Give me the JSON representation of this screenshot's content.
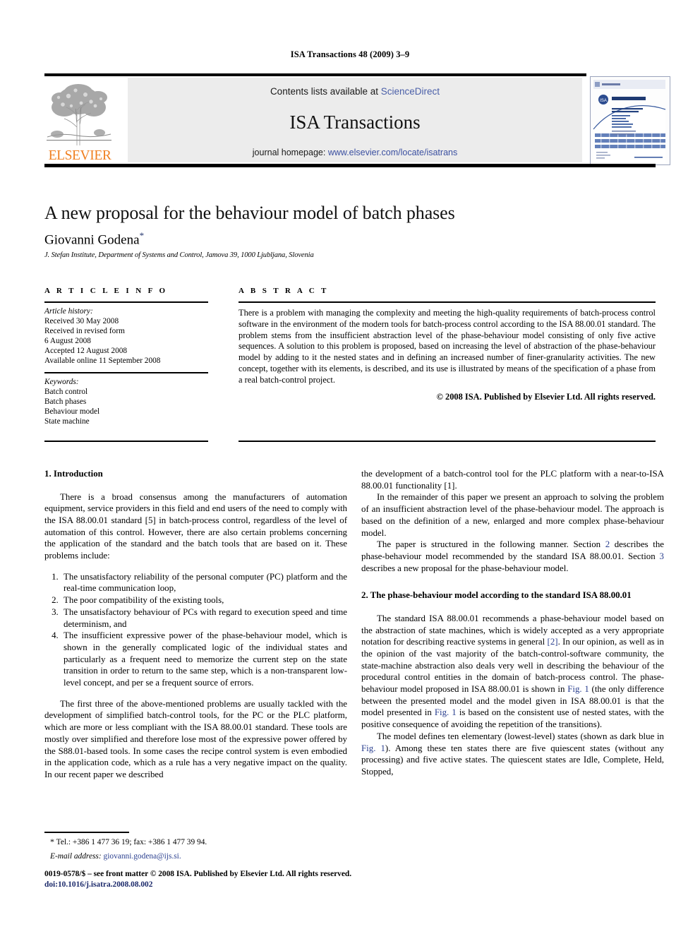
{
  "running_head": "ISA Transactions 48 (2009) 3–9",
  "masthead": {
    "publisher_name": "ELSEVIER",
    "contents_prefix": "Contents lists available at ",
    "contents_link": "ScienceDirect",
    "journal_name": "ISA Transactions",
    "homepage_prefix": "journal homepage: ",
    "homepage_url": "www.elsevier.com/locate/isatrans",
    "cover_header": "Transactions",
    "cover_logo_text": "ISA",
    "cover_title": "Transactions",
    "cover_subtitle": "The Science and Engineering of Measurement and Automation",
    "cover_footer": "Instrumentation, Systems, and Automation Society"
  },
  "title": "A new proposal for the behaviour model of batch phases",
  "author": "Giovanni Godena",
  "author_marker": "*",
  "affiliation": "J. Stefan Institute, Department of Systems and Control, Jamova 39, 1000 Ljubljana, Slovenia",
  "article_info": {
    "heading": "A R T I C L E   I N F O",
    "history_label": "Article history:",
    "history": [
      "Received 30 May 2008",
      "Received in revised form",
      "6 August 2008",
      "Accepted 12 August 2008",
      "Available online 11 September 2008"
    ],
    "keywords_label": "Keywords:",
    "keywords": [
      "Batch control",
      "Batch phases",
      "Behaviour model",
      "State machine"
    ]
  },
  "abstract": {
    "heading": "A B S T R A C T",
    "text": "There is a problem with managing the complexity and meeting the high-quality requirements of batch-process control software in the environment of the modern tools for batch-process control according to the ISA 88.00.01 standard. The problem stems from the insufficient abstraction level of the phase-behaviour model consisting of only five active sequences. A solution to this problem is proposed, based on increasing the level of abstraction of the phase-behaviour model by adding to it the nested states and in defining an increased number of finer-granularity activities. The new concept, together with its elements, is described, and its use is illustrated by means of the specification of a phase from a real batch-control project.",
    "copyright": "© 2008 ISA. Published by Elsevier Ltd. All rights reserved."
  },
  "sections": {
    "intro": {
      "heading": "1.  Introduction",
      "p1": "There is a broad consensus among the manufacturers of automation equipment, service providers in this field and end users of the need to comply with the ISA 88.00.01 standard [5] in batch-process control, regardless of the level of automation of this control. However, there are also certain problems concerning the application of the standard and the batch tools that are based on it. These problems include:",
      "p1_ref": "[5]",
      "problems": [
        "The unsatisfactory reliability of the personal computer (PC) platform and the real-time communication loop,",
        "The poor compatibility of the existing tools,",
        "The unsatisfactory behaviour of PCs with regard to execution speed and time determinism, and",
        "The insufficient expressive power of the phase-behaviour model, which is shown in the generally complicated logic of the individual states and particularly as a frequent need to memorize the current step on the state transition in order to return to the same step, which is a non-transparent low-level concept, and per se a frequent source of errors."
      ],
      "p2": "The first three of the above-mentioned problems are usually tackled with the development of simplified batch-control tools, for the PC or the PLC platform, which are more or less compliant with the ISA 88.00.01 standard. These tools are mostly over simplified and therefore lose most of the expressive power offered by the S88.01-based tools. In some cases the recipe control system is even embodied in the application code, which as a rule has a very negative impact on the quality. In our recent paper we described",
      "p2_cont": "the development of a batch-control tool for the PLC platform with a near-to-ISA 88.00.01 functionality [1].",
      "p3": "In the remainder of this paper we present an approach to solving the problem of an insufficient abstraction level of the phase-behaviour model. The approach is based on the definition of a new, enlarged and more complex phase-behaviour model.",
      "p4_a": "The paper is structured in the following manner. Section ",
      "p4_ref1": "2",
      "p4_b": " describes the phase-behaviour model recommended by the standard ISA 88.00.01. Section ",
      "p4_ref2": "3",
      "p4_c": " describes a new proposal for the phase-behaviour model."
    },
    "model": {
      "heading": "2.  The phase-behaviour model according to the standard ISA 88.00.01",
      "p1_a": "The standard ISA 88.00.01 recommends a phase-behaviour model based on the abstraction of state machines, which is widely accepted as a very appropriate notation for describing reactive systems in general ",
      "p1_ref": "[2]",
      "p1_b": ". In our opinion, as well as in the opinion of the vast majority of the batch-control-software community, the state-machine abstraction also deals very well in describing the behaviour of the  procedural control entities in the domain of batch-process control. The phase-behaviour model proposed in ISA 88.00.01 is shown in ",
      "p1_fig1": "Fig. 1",
      "p1_c": " (the only difference between the presented model and the model given in ISA 88.00.01 is that the model presented in ",
      "p1_fig2": "Fig. 1",
      "p1_d": " is based on the consistent use of nested states, with the positive consequence of avoiding the repetition of the transitions).",
      "p2_a": "The model defines ten elementary (lowest-level) states (shown as dark blue in ",
      "p2_fig": "Fig. 1",
      "p2_b": "). Among these ten states there are five quiescent states (without any processing) and five active states. The quiescent states are Idle, Complete, Held, Stopped,"
    }
  },
  "footnote": {
    "marker": "*",
    "line1": "Tel.: +386 1 477 36 19; fax: +386 1 477 39 94.",
    "email_label": "E-mail address:",
    "email": "giovanni.godena@ijs.si."
  },
  "colophon": {
    "line1": "0019-0578/$ – see front matter © 2008 ISA. Published by Elsevier Ltd. All rights reserved.",
    "doi": "doi:10.1016/j.isatra.2008.08.002"
  },
  "colors": {
    "link_blue": "#2a3f8f",
    "elsevier_orange": "#F07F20",
    "banner_gray": "#ececec"
  }
}
